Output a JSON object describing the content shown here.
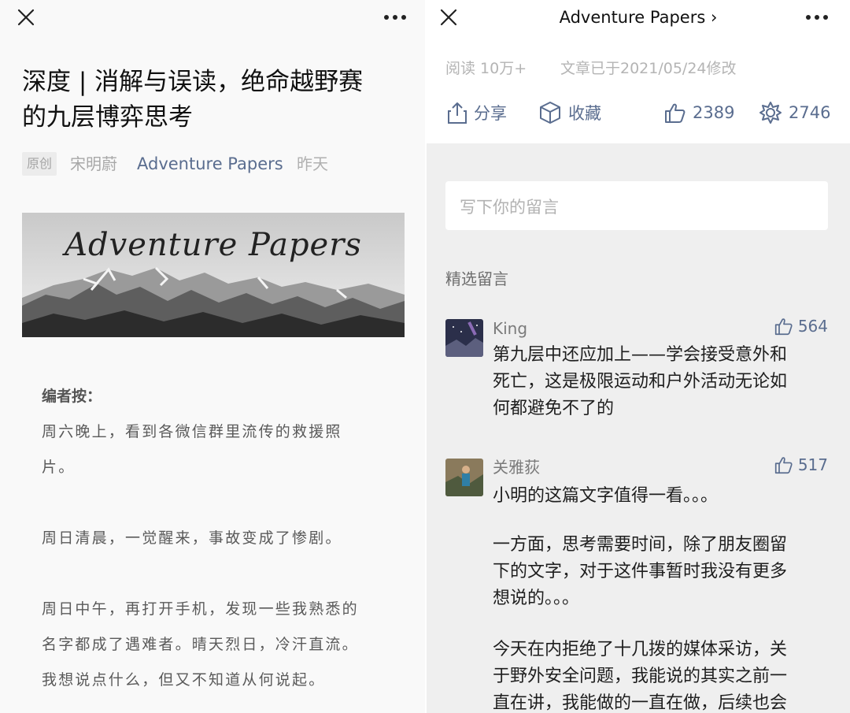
{
  "left": {
    "close_icon": "close-icon",
    "more_icon": "more-icon",
    "title_line1": "深度 | 消解与误读，绝命越野赛",
    "title_line2": "的九层博弈思考",
    "tag": "原创",
    "author": "宋明蔚",
    "account": "Adventure Papers",
    "time": "昨天",
    "banner_text": "Adventure Papers",
    "note_heading": "编者按：",
    "paragraphs": [
      "周六晚上，看到各微信群里流传的救援照",
      "片。",
      "周日清晨，一觉醒来，事故变成了惨剧。",
      "周日中午，再打开手机，发现一些我熟悉的",
      "名字都成了遇难者。晴天烈日，冷汗直流。",
      "我想说点什么，但又不知道从何说起。"
    ]
  },
  "right": {
    "close_icon": "close-icon",
    "more_icon": "more-icon",
    "title": "Adventure Papers",
    "reads": "阅读 10万+",
    "modified": "文章已于2021/05/24修改",
    "share": "分享",
    "favorite": "收藏",
    "likes": "2389",
    "wow": "2746",
    "comment_placeholder": "写下你的留言",
    "section_label": "精选留言",
    "comments": [
      {
        "name": "King",
        "likes": "564",
        "lines": [
          "第九层中还应加上——学会接受意外和",
          "死亡，这是极限运动和户外活动无论如",
          "何都避免不了的"
        ]
      },
      {
        "name": "关雅荻",
        "likes": "517",
        "lines": [
          "小明的这篇文字值得一看。。。",
          "一方面，思考需要时间，除了朋友圈留",
          "下的文字，对于这件事暂时我没有更多",
          "想说的。。。",
          "今天在内拒绝了十几拨的媒体采访，关",
          "于野外安全问题，我能说的其实之前一",
          "直在讲，我能做的一直在做，后续也会"
        ]
      }
    ]
  },
  "colors": {
    "link": "#5a6d8f",
    "muted": "#b4b4b4",
    "comments_bg": "#efefef"
  }
}
